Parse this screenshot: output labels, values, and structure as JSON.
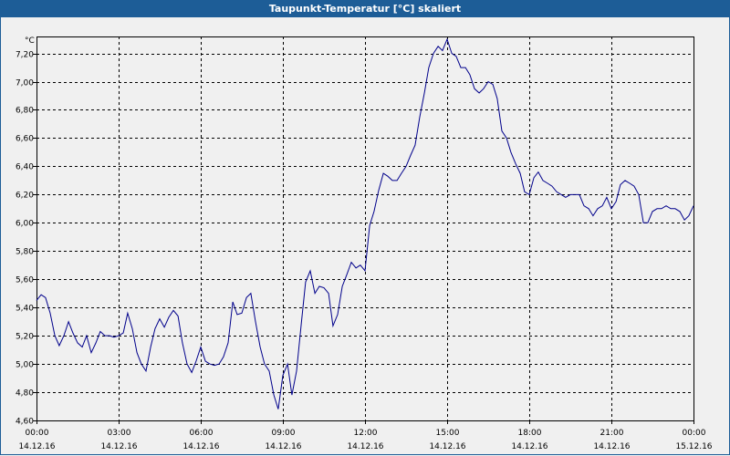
{
  "window": {
    "title": "Taupunkt-Temperatur [°C] skaliert"
  },
  "chart_data": {
    "type": "line",
    "title": "Taupunkt-Temperatur [°C] skaliert",
    "ylabel": "°C",
    "xlabel": "",
    "ylim": [
      4.6,
      7.32
    ],
    "y_ticks": [
      "7,20",
      "7,00",
      "6,80",
      "6,60",
      "6,40",
      "6,20",
      "6,00",
      "5,80",
      "5,60",
      "5,40",
      "5,20",
      "5,00",
      "4,80",
      "4,60"
    ],
    "y_tick_values": [
      7.2,
      7.0,
      6.8,
      6.6,
      6.4,
      6.2,
      6.0,
      5.8,
      5.6,
      5.4,
      5.2,
      5.0,
      4.8,
      4.6
    ],
    "x_ticks": [
      {
        "time": "00:00",
        "date": "14.12.16",
        "hour": 0
      },
      {
        "time": "03:00",
        "date": "14.12.16",
        "hour": 3
      },
      {
        "time": "06:00",
        "date": "14.12.16",
        "hour": 6
      },
      {
        "time": "09:00",
        "date": "14.12.16",
        "hour": 9
      },
      {
        "time": "12:00",
        "date": "14.12.16",
        "hour": 12
      },
      {
        "time": "15:00",
        "date": "14.12.16",
        "hour": 15
      },
      {
        "time": "18:00",
        "date": "14.12.16",
        "hour": 18
      },
      {
        "time": "21:00",
        "date": "14.12.16",
        "hour": 21
      },
      {
        "time": "00:00",
        "date": "15.12.16",
        "hour": 24
      }
    ],
    "xlim_hours": [
      0,
      24
    ],
    "grid": true,
    "line_color": "#00008b",
    "series": [
      {
        "x": [
          0,
          0.17,
          0.33,
          0.5,
          0.67,
          0.83,
          1.0,
          1.17,
          1.33,
          1.5,
          1.67,
          1.83,
          2.0,
          2.17,
          2.33,
          2.5,
          2.67,
          2.83,
          3.0,
          3.17,
          3.33,
          3.5,
          3.67,
          3.83,
          4.0,
          4.17,
          4.33,
          4.5,
          4.67,
          4.83,
          5.0,
          5.17,
          5.33,
          5.5,
          5.67,
          5.83,
          6.0,
          6.17,
          6.33,
          6.5,
          6.67,
          6.83,
          7.0,
          7.17,
          7.33,
          7.5,
          7.67,
          7.83,
          8.0,
          8.17,
          8.33,
          8.5,
          8.67,
          8.83,
          9.0,
          9.17,
          9.33,
          9.5,
          9.67,
          9.83,
          10.0,
          10.17,
          10.33,
          10.5,
          10.67,
          10.83,
          11.0,
          11.17,
          11.33,
          11.5,
          11.67,
          11.83,
          12.0,
          12.17,
          12.33,
          12.5,
          12.67,
          12.83,
          13.0,
          13.17,
          13.33,
          13.5,
          13.67,
          13.83,
          14.0,
          14.17,
          14.33,
          14.5,
          14.67,
          14.83,
          15.0,
          15.17,
          15.33,
          15.5,
          15.67,
          15.83,
          16.0,
          16.17,
          16.33,
          16.5,
          16.67,
          16.83,
          17.0,
          17.17,
          17.33,
          17.5,
          17.67,
          17.83,
          18.0,
          18.17,
          18.33,
          18.5,
          18.67,
          18.83,
          19.0,
          19.17,
          19.33,
          19.5,
          19.67,
          19.83,
          20.0,
          20.17,
          20.33,
          20.5,
          20.67,
          20.83,
          21.0,
          21.17,
          21.33,
          21.5,
          21.67,
          21.83,
          22.0,
          22.17,
          22.33,
          22.5,
          22.67,
          22.83,
          23.0,
          23.17,
          23.33,
          23.5,
          23.67,
          23.83,
          24.0
        ],
        "y": [
          5.45,
          5.49,
          5.47,
          5.36,
          5.2,
          5.13,
          5.2,
          5.3,
          5.22,
          5.15,
          5.12,
          5.2,
          5.08,
          5.15,
          5.23,
          5.2,
          5.2,
          5.19,
          5.2,
          5.22,
          5.36,
          5.25,
          5.08,
          5.0,
          4.95,
          5.12,
          5.25,
          5.32,
          5.26,
          5.33,
          5.38,
          5.34,
          5.15,
          5.0,
          4.94,
          5.02,
          5.12,
          5.02,
          5.0,
          4.99,
          5.0,
          5.05,
          5.15,
          5.44,
          5.35,
          5.36,
          5.47,
          5.5,
          5.3,
          5.12,
          5.0,
          4.95,
          4.78,
          4.68,
          4.92,
          5.0,
          4.78,
          4.95,
          5.28,
          5.58,
          5.66,
          5.5,
          5.55,
          5.54,
          5.5,
          5.27,
          5.35,
          5.55,
          5.63,
          5.72,
          5.68,
          5.7,
          5.66,
          5.98,
          6.08,
          6.23,
          6.35,
          6.33,
          6.3,
          6.3,
          6.35,
          6.4,
          6.48,
          6.55,
          6.75,
          6.92,
          7.1,
          7.2,
          7.25,
          7.22,
          7.3,
          7.2,
          7.18,
          7.1,
          7.1,
          7.05,
          6.95,
          6.92,
          6.95,
          7.0,
          6.98,
          6.88,
          6.65,
          6.6,
          6.5,
          6.42,
          6.35,
          6.22,
          6.2,
          6.32,
          6.36,
          6.3,
          6.28,
          6.26,
          6.22,
          6.2,
          6.18,
          6.2,
          6.2,
          6.2,
          6.12,
          6.1,
          6.05,
          6.1,
          6.12,
          6.18,
          6.1,
          6.15,
          6.27,
          6.3,
          6.28,
          6.26,
          6.2,
          6.0,
          6.0,
          6.08,
          6.1,
          6.1,
          6.12,
          6.1,
          6.1,
          6.08,
          6.02,
          6.05,
          6.12
        ]
      }
    ]
  }
}
